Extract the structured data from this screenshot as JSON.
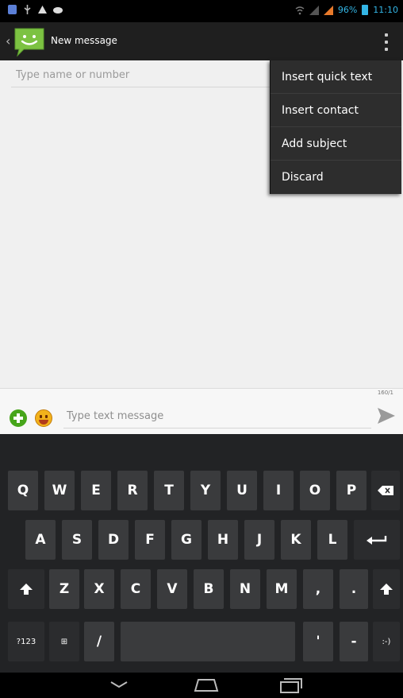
{
  "status_bar": {
    "battery": "96%",
    "time": "11:10",
    "icons": [
      "notification-icon",
      "usb-icon",
      "warning-icon",
      "cloud-icon",
      "wifi-icon",
      "signal-icon",
      "battery-icon"
    ]
  },
  "action_bar": {
    "title": "New message",
    "app_icon": "messaging-app-icon",
    "overflow_icon": "overflow-menu-icon"
  },
  "recipient": {
    "placeholder": "Type name or number",
    "value": ""
  },
  "menu": {
    "items": [
      {
        "label": "Insert quick text"
      },
      {
        "label": "Insert contact"
      },
      {
        "label": "Add subject"
      },
      {
        "label": "Discard"
      }
    ]
  },
  "compose": {
    "placeholder": "Type text message",
    "value": "",
    "char_count": "160/1",
    "add_icon": "add-attachment-icon",
    "emoji_icon": "emoji-icon",
    "send_icon": "send-icon"
  },
  "keyboard": {
    "row1": [
      "Q",
      "W",
      "E",
      "R",
      "T",
      "Y",
      "U",
      "I",
      "O",
      "P"
    ],
    "row2": [
      "A",
      "S",
      "D",
      "F",
      "G",
      "H",
      "J",
      "K",
      "L"
    ],
    "row3": [
      "Z",
      "X",
      "C",
      "V",
      "B",
      "N",
      "M",
      ",",
      "."
    ],
    "symbols_key": "?123",
    "settings_key": "⊞",
    "slash_key": "/",
    "apostrophe_key": "'",
    "dash_key": "-",
    "smiley_key": ":-)"
  },
  "colors": {
    "accent": "#33b5e5",
    "action_bar": "#1f1f1f",
    "content_bg": "#f0f0f0",
    "keyboard_bg": "#222325",
    "key_bg": "#3a3b3d",
    "add_green": "#46a51a"
  }
}
